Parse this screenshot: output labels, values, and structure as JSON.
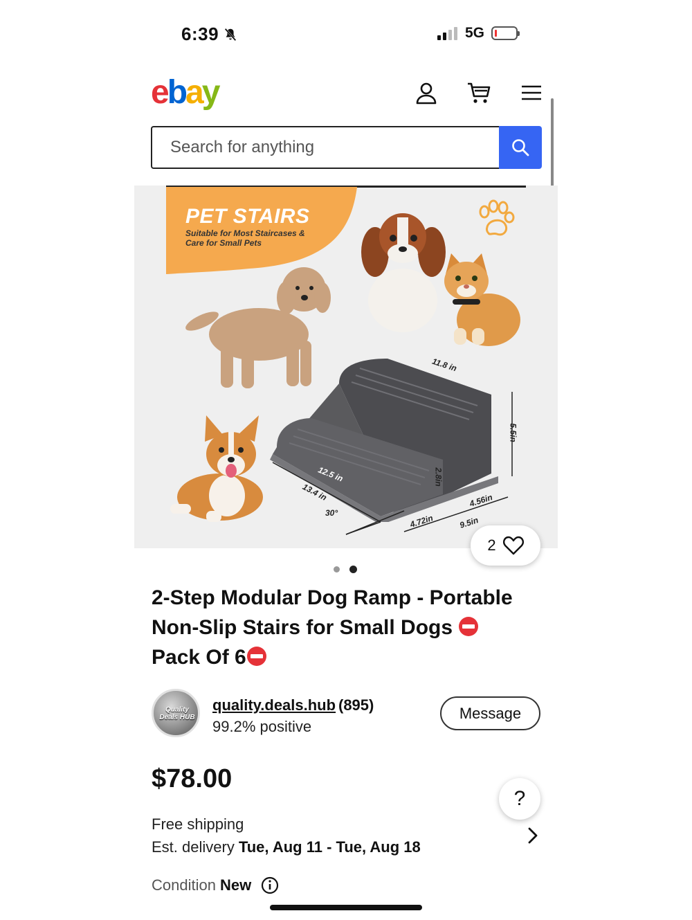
{
  "status_bar": {
    "time": "6:39",
    "network": "5G"
  },
  "header": {
    "logo": {
      "e": "e",
      "b": "b",
      "a": "a",
      "y": "y"
    },
    "icons": [
      "account-icon",
      "cart-icon",
      "menu-icon"
    ]
  },
  "search": {
    "placeholder": "Search for anything"
  },
  "product_image": {
    "banner_title": "PET STAIRS",
    "banner_subtitle": "Suitable for Most Staircases & Care for Small Pets",
    "dimensions": {
      "top_depth": "11.8 in",
      "height_total": "5.5in",
      "step_width": "12.5 in",
      "step_height": "2.8in",
      "base_length": "13.4 in",
      "angle": "30°",
      "lower_depth": "4.72in",
      "upper_depth": "4.56in",
      "total_depth": "9.5in"
    },
    "current_image": 2,
    "image_count": 2
  },
  "likes": {
    "count": "2"
  },
  "product": {
    "title_part1": "2-Step Modular Dog Ramp - Portable Non-Slip Stairs for Small Dogs",
    "title_part2": "Pack Of 6"
  },
  "seller": {
    "avatar_text": "Quality Deals HUB",
    "name": "quality.deals.hub",
    "feedback_count": "(895)",
    "positive": "99.2% positive",
    "message_label": "Message"
  },
  "pricing": {
    "price": "$78.00",
    "help_label": "?",
    "shipping": "Free shipping",
    "delivery_prefix": "Est. delivery ",
    "delivery_dates": "Tue, Aug 11 - Tue, Aug 18",
    "condition_label": "Condition ",
    "condition_value": "New"
  },
  "colors": {
    "search_button": "#3665f3",
    "banner_orange": "#f5a94e",
    "stairs_gray": "#5a5a5d",
    "stop_red": "#e53238"
  }
}
